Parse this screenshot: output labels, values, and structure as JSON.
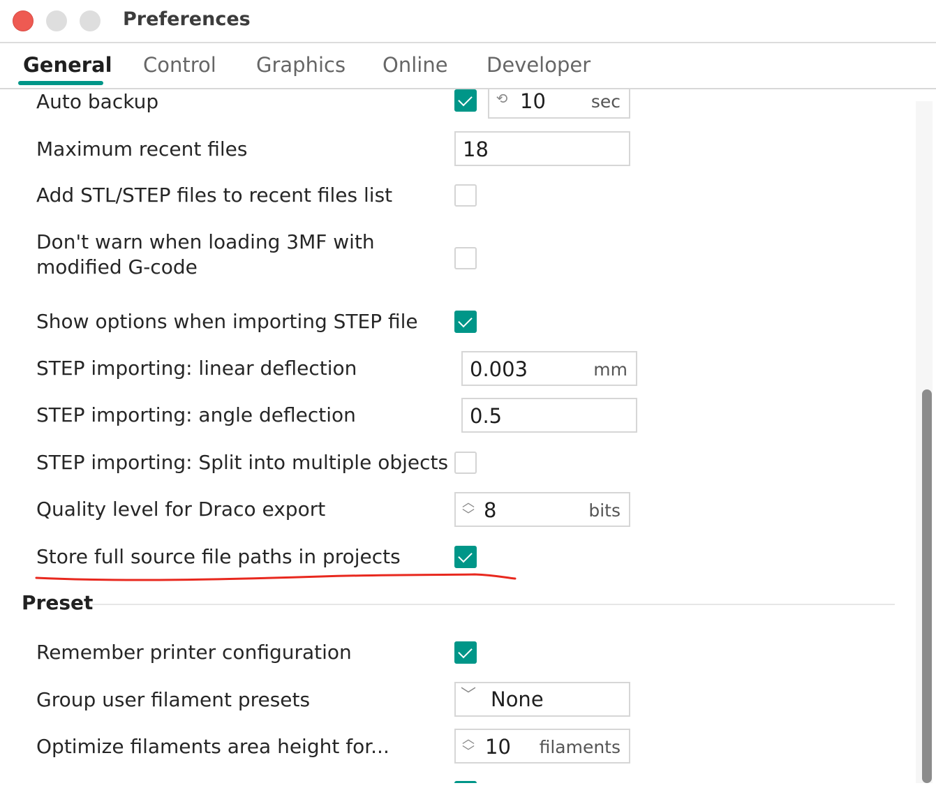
{
  "window": {
    "title": "Preferences"
  },
  "tabs": [
    {
      "label": "General",
      "active": true
    },
    {
      "label": "Control"
    },
    {
      "label": "Graphics"
    },
    {
      "label": "Online"
    },
    {
      "label": "Developer"
    }
  ],
  "general": {
    "auto_backup": {
      "label": "Auto backup",
      "checked": true,
      "value": "10",
      "unit": "sec"
    },
    "max_recent": {
      "label": "Maximum recent files",
      "value": "18"
    },
    "add_stl": {
      "label": "Add STL/STEP files to recent files list",
      "checked": false
    },
    "dont_warn": {
      "label_line1": "Don't warn when loading 3MF with",
      "label_line2": "modified G-code",
      "checked": false
    },
    "show_step_options": {
      "label": "Show options when importing STEP file",
      "checked": true
    },
    "step_linear": {
      "label": "STEP importing: linear deflection",
      "value": "0.003",
      "unit": "mm"
    },
    "step_angle": {
      "label": "STEP importing: angle deflection",
      "value": "0.5"
    },
    "step_split": {
      "label": "STEP importing: Split into multiple objects",
      "checked": false
    },
    "draco": {
      "label": "Quality level for Draco export",
      "value": "8",
      "unit": "bits"
    },
    "store_paths": {
      "label": "Store full source file paths in projects",
      "checked": true
    }
  },
  "preset": {
    "title": "Preset",
    "remember_printer": {
      "label": "Remember printer configuration",
      "checked": true
    },
    "group_filament": {
      "label": "Group user filament presets",
      "value": "None"
    },
    "optimize_filaments": {
      "label": "Optimize filaments area height for...",
      "value": "10",
      "unit": "filaments"
    }
  },
  "colors": {
    "accent": "#009688",
    "annotation": "#e8281e"
  }
}
